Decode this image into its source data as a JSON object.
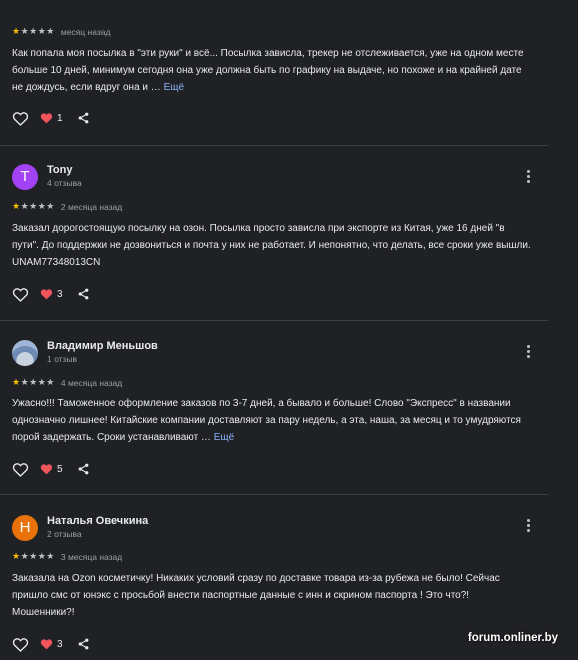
{
  "colors": {
    "background": "#202124",
    "star": "#fbbc04",
    "heart": "#f2545b",
    "link": "#8ab4f8"
  },
  "more_label": "Ещё",
  "reviews": [
    {
      "name": "",
      "review_count": "",
      "rating": 1,
      "date": "месяц назад",
      "text": "Как попала моя посылка в \"эти руки\" и всё... Посылка зависла, трекер не отслеживается, уже на одном месте больше 10 дней, минимум сегодня она уже должна быть по графику на выдаче, но похоже и на крайней дате не дождусь, если вдруг она и …",
      "likes": "1"
    },
    {
      "name": "Tony",
      "avatar_letter": "T",
      "avatar_color": "#a142f4",
      "review_count": "4 отзыва",
      "rating": 1,
      "date": "2 месяца назад",
      "text": "Заказал дорогостоящую посылку на озон. Посылка просто зависла при экспорте из Китая, уже 16 дней \"в пути\". До поддержки не дозвониться и почта у них не работает. И непонятно, что делать, все сроки уже вышли. UNAM77348013CN",
      "likes": "3"
    },
    {
      "name": "Владимир Меньшов",
      "avatar_letter": "",
      "review_count": "1 отзыв",
      "rating": 1,
      "date": "4 месяца назад",
      "text": "Ужасно!!! Таможенное оформление заказов по 3-7 дней, а бывало и больше! Слово \"Экспресс\" в названии однозначно лишнее! Китайские компании доставляют за пару недель, а эта, наша, за месяц и то умудряются порой задержать. Сроки устанавливают …",
      "likes": "5"
    },
    {
      "name": "Наталья Овечкина",
      "avatar_letter": "Н",
      "avatar_color": "#e8710a",
      "review_count": "2 отзыва",
      "rating": 1,
      "date": "3 месяца назад",
      "text": "Заказала на Ozon косметичку! Никаких условий сразу по доставке товара из-за рубежа не было! Сейчас пришло смс от юнэкс с просьбой внести паспортные данные с инн и скрином паспорта ! Это что?! Мошенники?!",
      "likes": "3"
    }
  ],
  "watermark": "forum.onliner.by"
}
